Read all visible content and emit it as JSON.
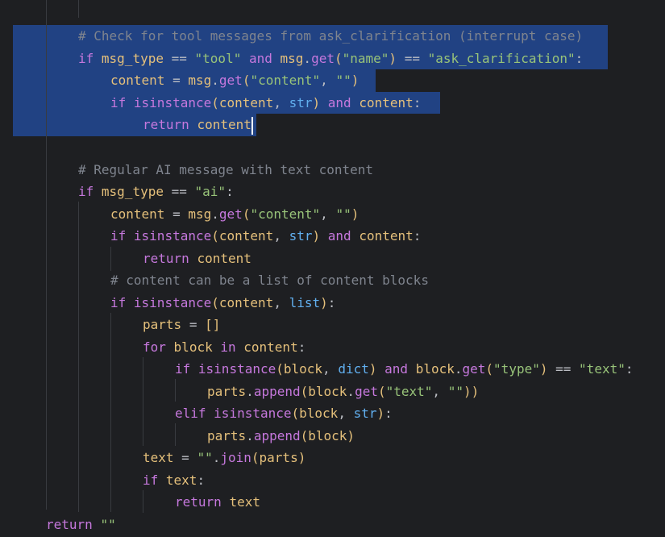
{
  "colors": {
    "background": "#1e1f22",
    "selection": "#214283",
    "keyword": "#c678dd",
    "identifier": "#e5c07b",
    "comment": "#7f848e",
    "string": "#98c379",
    "builtin": "#61afef"
  },
  "code": {
    "lines": [
      "    # Check for tool messages from ask_clarification (interrupt case)",
      "    if msg_type == \"tool\" and msg.get(\"name\") == \"ask_clarification\":",
      "        content = msg.get(\"content\", \"\")",
      "        if isinstance(content, str) and content:",
      "            return content",
      "",
      "    # Regular AI message with text content",
      "    if msg_type == \"ai\":",
      "        content = msg.get(\"content\", \"\")",
      "        if isinstance(content, str) and content:",
      "            return content",
      "        # content can be a list of content blocks",
      "        if isinstance(content, list):",
      "            parts = []",
      "            for block in content:",
      "                if isinstance(block, dict) and block.get(\"type\") == \"text\":",
      "                    parts.append(block.get(\"text\", \"\"))",
      "                elif isinstance(block, str):",
      "                    parts.append(block)",
      "            text = \"\".join(parts)",
      "            if text:",
      "                return text",
      "return \"\""
    ]
  }
}
